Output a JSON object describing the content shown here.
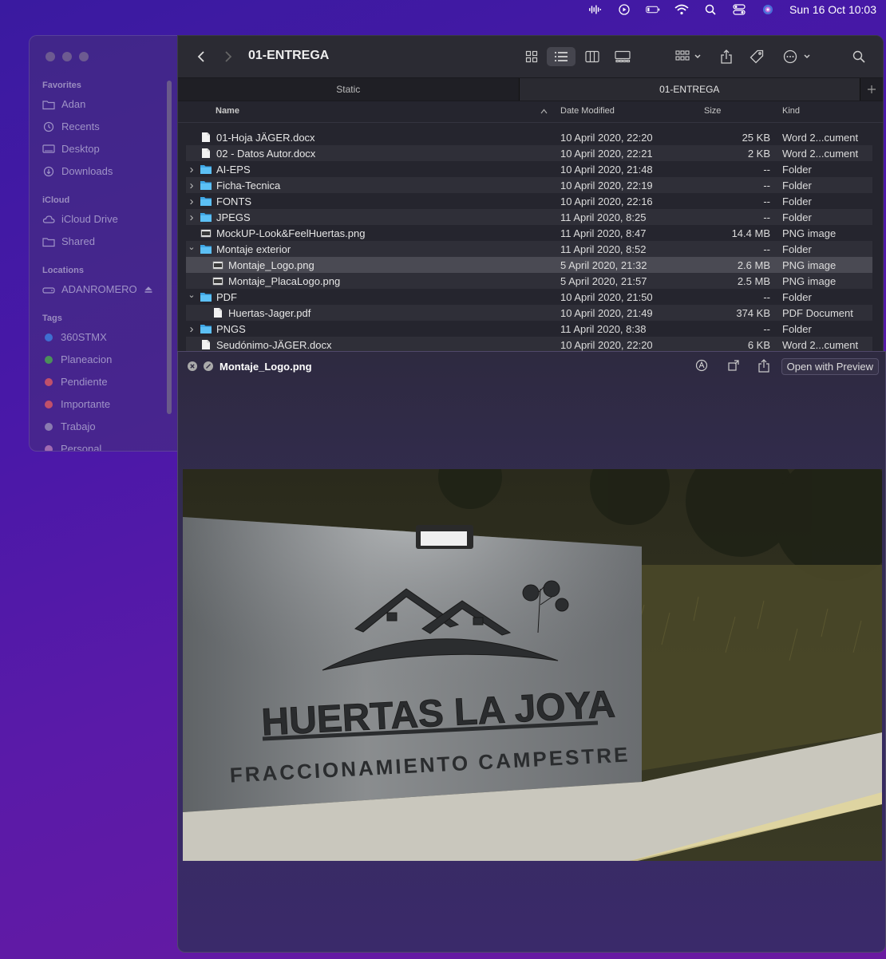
{
  "menubar": {
    "date_time": "Sun 16 Oct  10:03"
  },
  "sidebar": {
    "favorites_label": "Favorites",
    "favorites": [
      "Adan",
      "Recents",
      "Desktop",
      "Downloads"
    ],
    "icloud_label": "iCloud",
    "icloud": [
      "iCloud Drive",
      "Shared"
    ],
    "locations_label": "Locations",
    "locations": [
      "ADANROMERO"
    ],
    "tags_label": "Tags",
    "tags": [
      {
        "name": "360STMX",
        "color": "#3f6fd0"
      },
      {
        "name": "Planeacion",
        "color": "#4b8f5a"
      },
      {
        "name": "Pendiente",
        "color": "#c0506a"
      },
      {
        "name": "Importante",
        "color": "#c0506a"
      },
      {
        "name": "Trabajo",
        "color": "#8a7ab0"
      },
      {
        "name": "Personal",
        "color": "#a06ab0"
      }
    ]
  },
  "finder": {
    "title": "01-ENTREGA",
    "tabs": [
      "Static",
      "01-ENTREGA"
    ],
    "columns": {
      "name": "Name",
      "date": "Date Modified",
      "size": "Size",
      "kind": "Kind"
    },
    "rows": [
      {
        "name": "01-Hoja JÄGER.docx",
        "date": "10 April 2020, 22:20",
        "size": "25 KB",
        "kind": "Word 2...cument",
        "type": "doc",
        "indent": 0
      },
      {
        "name": "02 - Datos Autor.docx",
        "date": "10 April 2020, 22:21",
        "size": "2 KB",
        "kind": "Word 2...cument",
        "type": "doc",
        "indent": 0
      },
      {
        "name": "AI-EPS",
        "date": "10 April 2020, 21:48",
        "size": "--",
        "kind": "Folder",
        "type": "folder",
        "indent": 0,
        "expand": "closed"
      },
      {
        "name": "Ficha-Tecnica",
        "date": "10 April 2020, 22:19",
        "size": "--",
        "kind": "Folder",
        "type": "folder",
        "indent": 0,
        "expand": "closed"
      },
      {
        "name": "FONTS",
        "date": "10 April 2020, 22:16",
        "size": "--",
        "kind": "Folder",
        "type": "folder",
        "indent": 0,
        "expand": "closed"
      },
      {
        "name": "JPEGS",
        "date": "11 April 2020, 8:25",
        "size": "--",
        "kind": "Folder",
        "type": "folder",
        "indent": 0,
        "expand": "closed"
      },
      {
        "name": "MockUP-Look&FeelHuertas.png",
        "date": "11 April 2020, 8:47",
        "size": "14.4 MB",
        "kind": "PNG image",
        "type": "img",
        "indent": 0
      },
      {
        "name": "Montaje exterior",
        "date": "11 April 2020, 8:52",
        "size": "--",
        "kind": "Folder",
        "type": "folder",
        "indent": 0,
        "expand": "open"
      },
      {
        "name": "Montaje_Logo.png",
        "date": "5 April 2020, 21:32",
        "size": "2.6 MB",
        "kind": "PNG image",
        "type": "img",
        "indent": 1,
        "selected": true
      },
      {
        "name": "Montaje_PlacaLogo.png",
        "date": "5 April 2020, 21:57",
        "size": "2.5 MB",
        "kind": "PNG image",
        "type": "img",
        "indent": 1
      },
      {
        "name": "PDF",
        "date": "10 April 2020, 21:50",
        "size": "--",
        "kind": "Folder",
        "type": "folder",
        "indent": 0,
        "expand": "open"
      },
      {
        "name": "Huertas-Jager.pdf",
        "date": "10 April 2020, 21:49",
        "size": "374 KB",
        "kind": "PDF Document",
        "type": "doc",
        "indent": 1
      },
      {
        "name": "PNGS",
        "date": "11 April 2020, 8:38",
        "size": "--",
        "kind": "Folder",
        "type": "folder",
        "indent": 0,
        "expand": "closed"
      },
      {
        "name": "Seudónimo-JÄGER.docx",
        "date": "10 April 2020, 22:20",
        "size": "6 KB",
        "kind": "Word 2...cument",
        "type": "doc",
        "indent": 0
      }
    ]
  },
  "quicklook": {
    "filename": "Montaje_Logo.png",
    "open_label": "Open with Preview",
    "image": {
      "headline": "HUERTAS LA JOYA",
      "subline": "FRACCIONAMIENTO CAMPESTRE"
    }
  }
}
